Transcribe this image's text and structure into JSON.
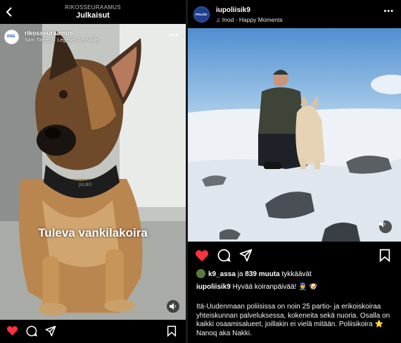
{
  "left_post": {
    "header_subtitle": "RIKOSSEURAAMUS",
    "header_title": "Julkaisut",
    "avatar_text": "RISE",
    "username": "rikosseuraamus",
    "music": "Sam Tinnesz · Legends Are Made",
    "more": "•••",
    "caption_overlay": "Tuleva vankilakoira",
    "collar_text": "JULBO",
    "liked": true
  },
  "right_post": {
    "avatar_text": "POLIISI",
    "username": "iupoliisik9",
    "music": "Inod · Happy Moments",
    "more": "•••",
    "liked": true,
    "likes_user": "k9_assa",
    "likes_conj": " ja ",
    "likes_count": "839 muuta",
    "likes_suffix": " tykkäävät",
    "caption_user": "iupoliisik9",
    "caption_text": " Hyvää koiranpäivää! 👮 🐶",
    "body": "Itä-Uudenmaan poliisissa on noin 25 partio- ja erikoiskoiraa yhteiskunnan palveluksessa, kokeneita sekä nuoria. Osalla on kaikki osaamisalueet, joillakin ei vielä mitään. Poliisikoira ⭐ Nanoq aka Nakki."
  },
  "colors": {
    "like_red": "#ff3040",
    "background": "#000000",
    "text": "#ffffff"
  },
  "icons": [
    "back-arrow-icon",
    "heart-icon",
    "comment-icon",
    "share-icon",
    "bookmark-icon",
    "sound-icon",
    "music-note-icon",
    "more-icon"
  ]
}
